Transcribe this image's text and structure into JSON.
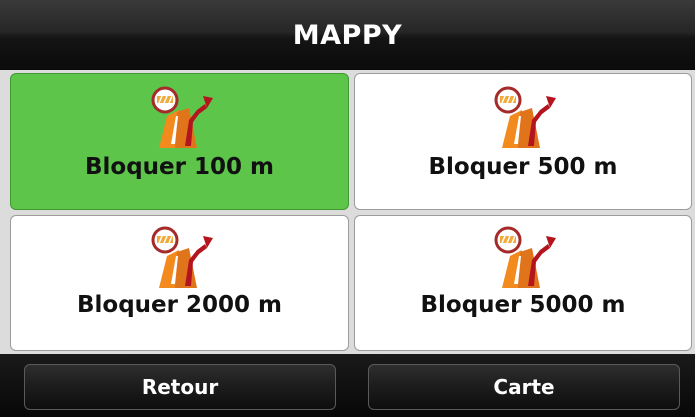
{
  "header": {
    "title": "MAPPY"
  },
  "options": [
    {
      "label": "Bloquer 100 m",
      "icon": "road-block-detour-icon",
      "selected": true
    },
    {
      "label": "Bloquer 500 m",
      "icon": "road-block-detour-icon",
      "selected": false
    },
    {
      "label": "Bloquer 2000 m",
      "icon": "road-block-detour-icon",
      "selected": false
    },
    {
      "label": "Bloquer 5000 m",
      "icon": "road-block-detour-icon",
      "selected": false
    }
  ],
  "footer": {
    "back_label": "Retour",
    "map_label": "Carte"
  },
  "colors": {
    "selected": "#5cc54a",
    "tile": "#ffffff",
    "road": "#f28a1e",
    "detour": "#b3141e",
    "sign_ring": "#a52a2a"
  }
}
